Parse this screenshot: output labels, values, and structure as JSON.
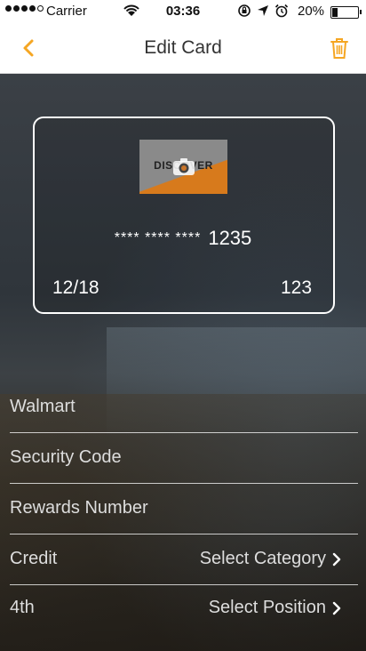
{
  "status_bar": {
    "carrier": "Carrier",
    "time": "03:36",
    "battery": "20%"
  },
  "nav": {
    "title": "Edit Card",
    "accent_color": "#f5a623"
  },
  "card": {
    "brand": "DISCOVER",
    "number_mask": "**** **** ****",
    "number_last4": "1235",
    "expiry": "12/18",
    "cvv": "123"
  },
  "form": {
    "card_name": "Walmart",
    "security_code_placeholder": "Security Code",
    "rewards_number_placeholder": "Rewards Number",
    "type_label": "Credit",
    "category_value": "Select Category",
    "position_label": "4th",
    "position_value": "Select Position"
  }
}
